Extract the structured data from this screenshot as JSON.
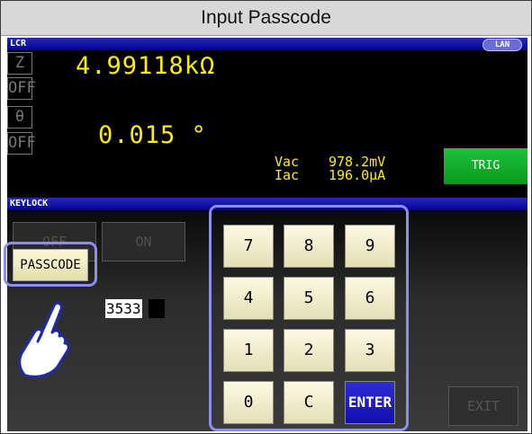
{
  "title": "Input Passcode",
  "status_bar": {
    "mode": "LCR",
    "lan_badge": "LAN"
  },
  "measurement": {
    "param1": {
      "label": "Z",
      "value": "4.99118kΩ"
    },
    "param1_off": "OFF",
    "param2": {
      "label": "θ",
      "value": "0.015 °"
    },
    "param2_off": "OFF",
    "vac_label": "Vac",
    "vac_value": "978.2mV",
    "iac_label": "Iac",
    "iac_value": "196.0μA",
    "trig_label": "TRIG"
  },
  "keylock": {
    "section_label": "KEYLOCK",
    "off_label": "OFF",
    "on_label": "ON",
    "passcode_label": "PASSCODE",
    "passcode_value": "3533"
  },
  "keypad": {
    "keys": [
      "7",
      "8",
      "9",
      "4",
      "5",
      "6",
      "1",
      "2",
      "3",
      "0",
      "C",
      "ENTER"
    ]
  },
  "exit_label": "EXIT",
  "colors": {
    "accent_yellow": "#ffee00",
    "trig_green": "#13b02a",
    "bar_blue": "#000098",
    "highlight": "#8e8ef2"
  },
  "icons": [
    "pointing-hand-icon"
  ]
}
